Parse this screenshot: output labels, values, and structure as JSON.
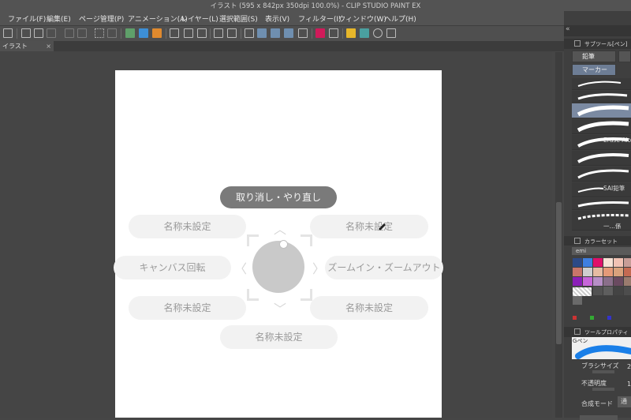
{
  "window": {
    "title": "イラスト (595 x 842px 350dpi 100.0%) - CLIP STUDIO PAINT EX"
  },
  "menu": [
    "ファイル(F)",
    "編集(E)",
    "ページ管理(P)",
    "アニメーション(A)",
    "レイヤー(L)",
    "選択範囲(S)",
    "表示(V)",
    "フィルター(I)",
    "ウィンドウ(W)",
    "ヘルプ(H)"
  ],
  "document_tab": {
    "label": "イラスト",
    "close": "×"
  },
  "radial_menu": {
    "top": "取り消し・やり直し",
    "upper_left": "名称未設定",
    "upper_right": "名称未設定",
    "left": "キャンバス回転",
    "right": "ズームイン・ズームアウト",
    "lower_left": "名称未設定",
    "lower_right": "名称未設定",
    "bottom": "名称未設定"
  },
  "sub_tool_panel": {
    "header": "サブツール[ペン]",
    "tool_groups": [
      "鉛筆",
      "マーカー"
    ],
    "brushes": [
      {
        "name": ""
      },
      {
        "name": ""
      },
      {
        "name": ""
      },
      {
        "name": ""
      },
      {
        "name": "Erase Alo"
      },
      {
        "name": ""
      },
      {
        "name": ""
      },
      {
        "name": "SAI鉛筆"
      },
      {
        "name": ""
      },
      {
        "name": ""
      },
      {
        "name": "一…係"
      }
    ]
  },
  "color_set_panel": {
    "header": "カラーセット",
    "set_name": "emi",
    "swatches": [
      "#2c4a86",
      "#3f7fe0",
      "#e0106a",
      "#f7e2d5",
      "#f1c2b4",
      "#c79d97",
      "#c8766a",
      "#cfcfcf",
      "#e6bca2",
      "#e59a78",
      "#d9a27c",
      "#c46a52",
      "#8b1fb8",
      "#c766d9",
      "#b78fc6",
      "#8a6f8a",
      "#6a4a60",
      "#9a7b6e",
      "#595959",
      "#3a3a3a",
      "#525252",
      "#5e5e5e",
      "#444",
      "#4d4d4d",
      "#6a6a6a"
    ]
  },
  "tool_property_panel": {
    "header": "ツールプロパティ",
    "tool_name": "Gペン",
    "brush_size_label": "ブラシサイズ",
    "brush_size_value": "2",
    "opacity_label": "不透明度",
    "opacity_value": "1",
    "blend_label": "合成モード",
    "blend_value": "通"
  }
}
